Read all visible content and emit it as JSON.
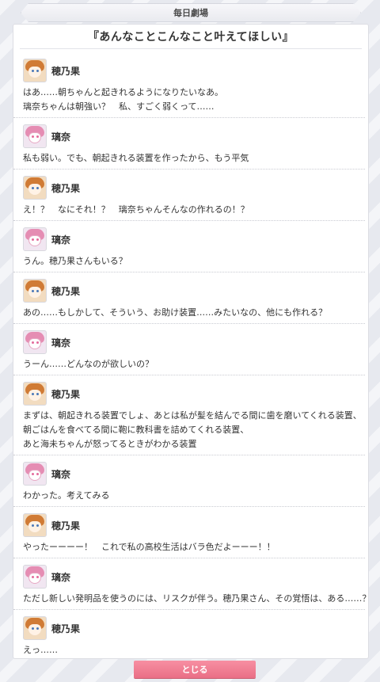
{
  "header": {
    "title": "毎日劇場"
  },
  "episode": {
    "title": "『あんなことこんなこと叶えてほしい』"
  },
  "dialogue": [
    {
      "speaker": "穂乃果",
      "avatar": "honoka",
      "lines": [
        "はあ……朝ちゃんと起きれるようになりたいなあ。",
        "璃奈ちゃんは朝強い？　私、すごく弱くって……"
      ]
    },
    {
      "speaker": "璃奈",
      "avatar": "rina",
      "lines": [
        "私も弱い。でも、朝起きれる装置を作ったから、もう平気"
      ]
    },
    {
      "speaker": "穂乃果",
      "avatar": "honoka",
      "lines": [
        "え！？　なにそれ！？　璃奈ちゃんそんなの作れるの！？"
      ]
    },
    {
      "speaker": "璃奈",
      "avatar": "rina",
      "lines": [
        "うん。穂乃果さんもいる？"
      ]
    },
    {
      "speaker": "穂乃果",
      "avatar": "honoka",
      "lines": [
        "あの……もしかして、そういう、お助け装置……みたいなの、他にも作れる？"
      ]
    },
    {
      "speaker": "璃奈",
      "avatar": "rina",
      "lines": [
        "うーん……どんなのが欲しいの？"
      ]
    },
    {
      "speaker": "穂乃果",
      "avatar": "honoka",
      "lines": [
        "まずは、朝起きれる装置でしょ、あとは私が髪を結んでる間に歯を磨いてくれる装置、",
        "朝ごはんを食べてる間に鞄に教科書を詰めてくれる装置、",
        "あと海未ちゃんが怒ってるときがわかる装置"
      ]
    },
    {
      "speaker": "璃奈",
      "avatar": "rina",
      "lines": [
        "わかった。考えてみる"
      ]
    },
    {
      "speaker": "穂乃果",
      "avatar": "honoka",
      "lines": [
        "やったーーーー！　これで私の高校生活はバラ色だよーーー！！"
      ]
    },
    {
      "speaker": "璃奈",
      "avatar": "rina",
      "lines": [
        "ただし新しい発明品を使うのには、リスクが伴う。穂乃果さん、その覚悟は、ある……？"
      ]
    },
    {
      "speaker": "穂乃果",
      "avatar": "honoka",
      "lines": [
        "えっ……"
      ]
    }
  ],
  "footer": {
    "close_label": "とじる"
  },
  "colors": {
    "accent": "#ee7890",
    "panel": "#ffffff",
    "background": "#e7e9ef"
  }
}
